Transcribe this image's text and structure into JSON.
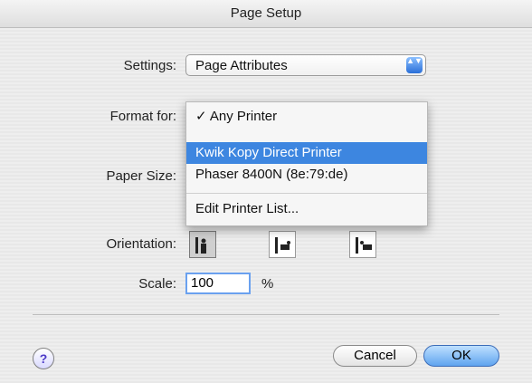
{
  "window": {
    "title": "Page Setup"
  },
  "settings": {
    "label": "Settings:",
    "value": "Page Attributes",
    "stepper": "▲▼"
  },
  "format_for": {
    "label": "Format for:"
  },
  "paper_size": {
    "label": "Paper Size:"
  },
  "orientation": {
    "label": "Orientation:",
    "selected_index": 0
  },
  "scale": {
    "label": "Scale:",
    "value": "100",
    "unit": "%"
  },
  "menu": {
    "items": [
      {
        "label": "✓ Any Printer",
        "selected": false
      },
      {
        "label": "Kwik Kopy Direct Printer",
        "selected": true
      },
      {
        "label": "Phaser 8400N (8e:79:de)",
        "selected": false
      },
      {
        "label": "Edit Printer List...",
        "selected": false
      }
    ]
  },
  "help": {
    "glyph": "?"
  },
  "buttons": {
    "cancel": "Cancel",
    "ok": "OK"
  },
  "colors": {
    "selection": "#3d86e0",
    "ok_button": "#5fa4ef"
  }
}
